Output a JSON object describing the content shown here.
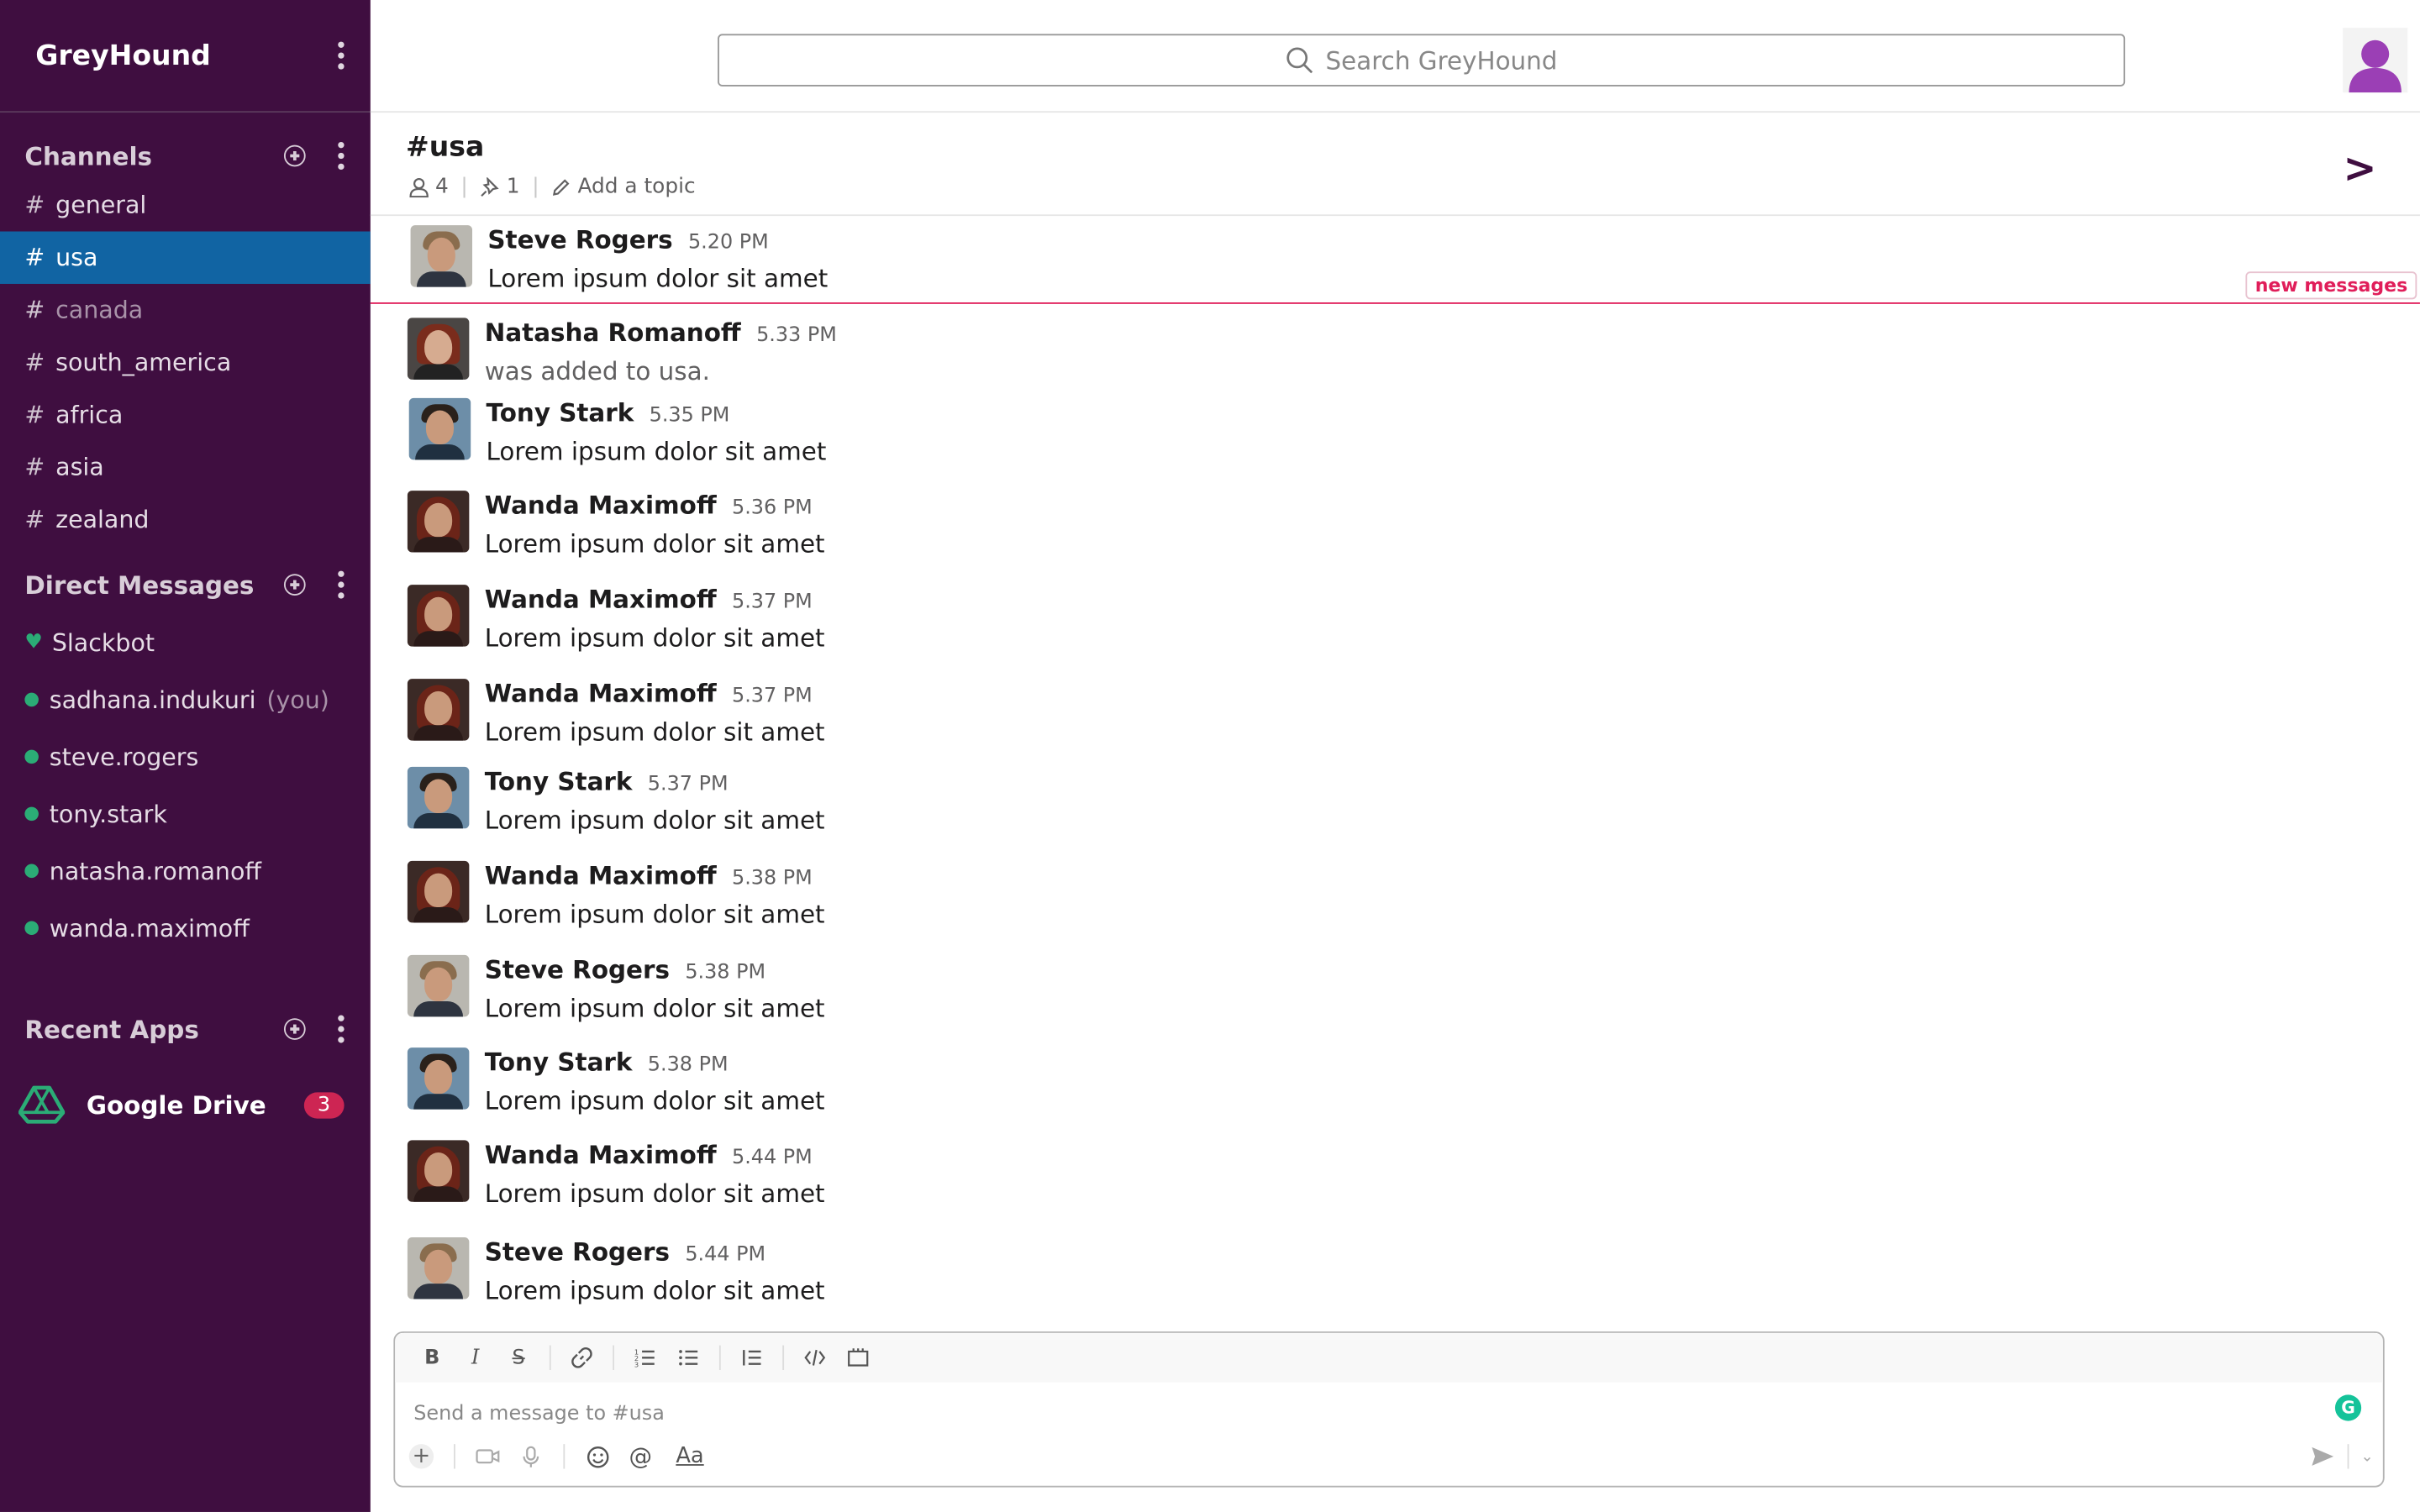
{
  "workspace": {
    "name": "GreyHound"
  },
  "search": {
    "placeholder": "Search GreyHound"
  },
  "sidebar": {
    "channels_title": "Channels",
    "channels": [
      {
        "name": "general",
        "state": "normal"
      },
      {
        "name": "usa",
        "state": "active"
      },
      {
        "name": "canada",
        "state": "muted"
      },
      {
        "name": "south_america",
        "state": "normal"
      },
      {
        "name": "africa",
        "state": "normal"
      },
      {
        "name": "asia",
        "state": "normal"
      },
      {
        "name": "zealand",
        "state": "normal"
      }
    ],
    "hash": "#",
    "dm_title": "Direct Messages",
    "dms": [
      {
        "name": "Slackbot",
        "icon": "heart"
      },
      {
        "name": "sadhana.indukuri",
        "suffix": "(you)",
        "icon": "dot"
      },
      {
        "name": "steve.rogers",
        "icon": "dot"
      },
      {
        "name": "tony.stark",
        "icon": "dot"
      },
      {
        "name": "natasha.romanoff",
        "icon": "dot"
      },
      {
        "name": "wanda.maximoff",
        "icon": "dot"
      }
    ],
    "apps_title": "Recent Apps",
    "apps": [
      {
        "name": "Google Drive",
        "badge": "3"
      }
    ]
  },
  "channel": {
    "title": "#usa",
    "members": "4",
    "pins": "1",
    "topic": "Add a topic"
  },
  "messages": [
    {
      "author": "Steve Rogers",
      "time": "5.20 PM",
      "text": "Lorem ipsum dolor sit amet",
      "avatar": "steve"
    },
    {
      "author": "Natasha Romanoff",
      "time": "5.33 PM",
      "text": "was added to usa.",
      "avatar": "nat",
      "system": true
    },
    {
      "author": "Tony Stark",
      "time": "5.35 PM",
      "text": "Lorem ipsum dolor sit amet",
      "avatar": "tony"
    },
    {
      "author": "Wanda Maximoff",
      "time": "5.36 PM",
      "text": "Lorem ipsum dolor sit amet",
      "avatar": "wanda"
    },
    {
      "author": "Wanda Maximoff",
      "time": "5.37 PM",
      "text": "Lorem ipsum dolor sit amet",
      "avatar": "wanda"
    },
    {
      "author": "Wanda Maximoff",
      "time": "5.37 PM",
      "text": "Lorem ipsum dolor sit amet",
      "avatar": "wanda"
    },
    {
      "author": "Tony Stark",
      "time": "5.37 PM",
      "text": "Lorem ipsum dolor sit amet",
      "avatar": "tony"
    },
    {
      "author": "Wanda Maximoff",
      "time": "5.38 PM",
      "text": "Lorem ipsum dolor sit amet",
      "avatar": "wanda"
    },
    {
      "author": "Steve Rogers",
      "time": "5.38 PM",
      "text": "Lorem ipsum dolor sit amet",
      "avatar": "steve"
    },
    {
      "author": "Tony Stark",
      "time": "5.38 PM",
      "text": "Lorem ipsum dolor sit amet",
      "avatar": "tony"
    },
    {
      "author": "Wanda Maximoff",
      "time": "5.44 PM",
      "text": "Lorem ipsum dolor sit amet",
      "avatar": "wanda"
    },
    {
      "author": "Steve Rogers",
      "time": "5.44 PM",
      "text": "Lorem ipsum dolor sit amet",
      "avatar": "steve"
    }
  ],
  "new_messages_label": "new messages",
  "composer": {
    "placeholder": "Send a message to #usa",
    "format_labels": {
      "bold": "B",
      "italic": "I",
      "strike": "S",
      "aa": "Aa",
      "at": "@"
    },
    "grammarly": "G"
  },
  "colors": {
    "sidebar_bg": "#3f0e40",
    "active_channel": "#1164a3",
    "presence": "#2bac76",
    "badge": "#cd2553",
    "new_messages": "#e01e5a"
  }
}
